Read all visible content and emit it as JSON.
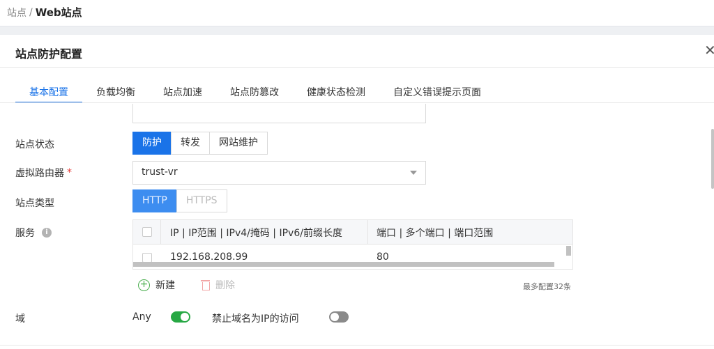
{
  "breadcrumb": {
    "parent": "站点",
    "separator": "/",
    "current": "Web站点"
  },
  "panel": {
    "title": "站点防护配置",
    "close_icon": "close-icon"
  },
  "tabs": [
    {
      "label": "基本配置",
      "active": true
    },
    {
      "label": "负载均衡"
    },
    {
      "label": "站点加速"
    },
    {
      "label": "站点防篡改"
    },
    {
      "label": "健康状态检测"
    },
    {
      "label": "自定义错误提示页面"
    }
  ],
  "form": {
    "site_status": {
      "label": "站点状态",
      "options": [
        "防护",
        "转发",
        "网站维护"
      ],
      "selected": "防护"
    },
    "virtual_router": {
      "label": "虚拟路由器",
      "required_mark": "*",
      "value": "trust-vr"
    },
    "site_type": {
      "label": "站点类型",
      "options": [
        "HTTP",
        "HTTPS"
      ],
      "selected": "HTTP"
    },
    "service": {
      "label": "服务",
      "info_icon": "i",
      "columns": [
        "IP | IP范围 | IPv4/掩码 | IPv6/前缀长度",
        "端口 | 多个端口 | 端口范围"
      ],
      "rows": [
        {
          "ip": "192.168.208.99",
          "port": "80"
        }
      ],
      "add_label": "新建",
      "delete_label": "删除",
      "max_note": "最多配置32条"
    },
    "domain": {
      "label": "域",
      "any_label": "Any",
      "any_on": true,
      "deny_ip_label": "禁止域名为IP的访问",
      "deny_ip_on": false
    }
  },
  "colors": {
    "accent": "#1a73e8",
    "toggle_on": "#27a844",
    "toggle_off": "#8a8a8a",
    "add_green": "#4caf50"
  }
}
